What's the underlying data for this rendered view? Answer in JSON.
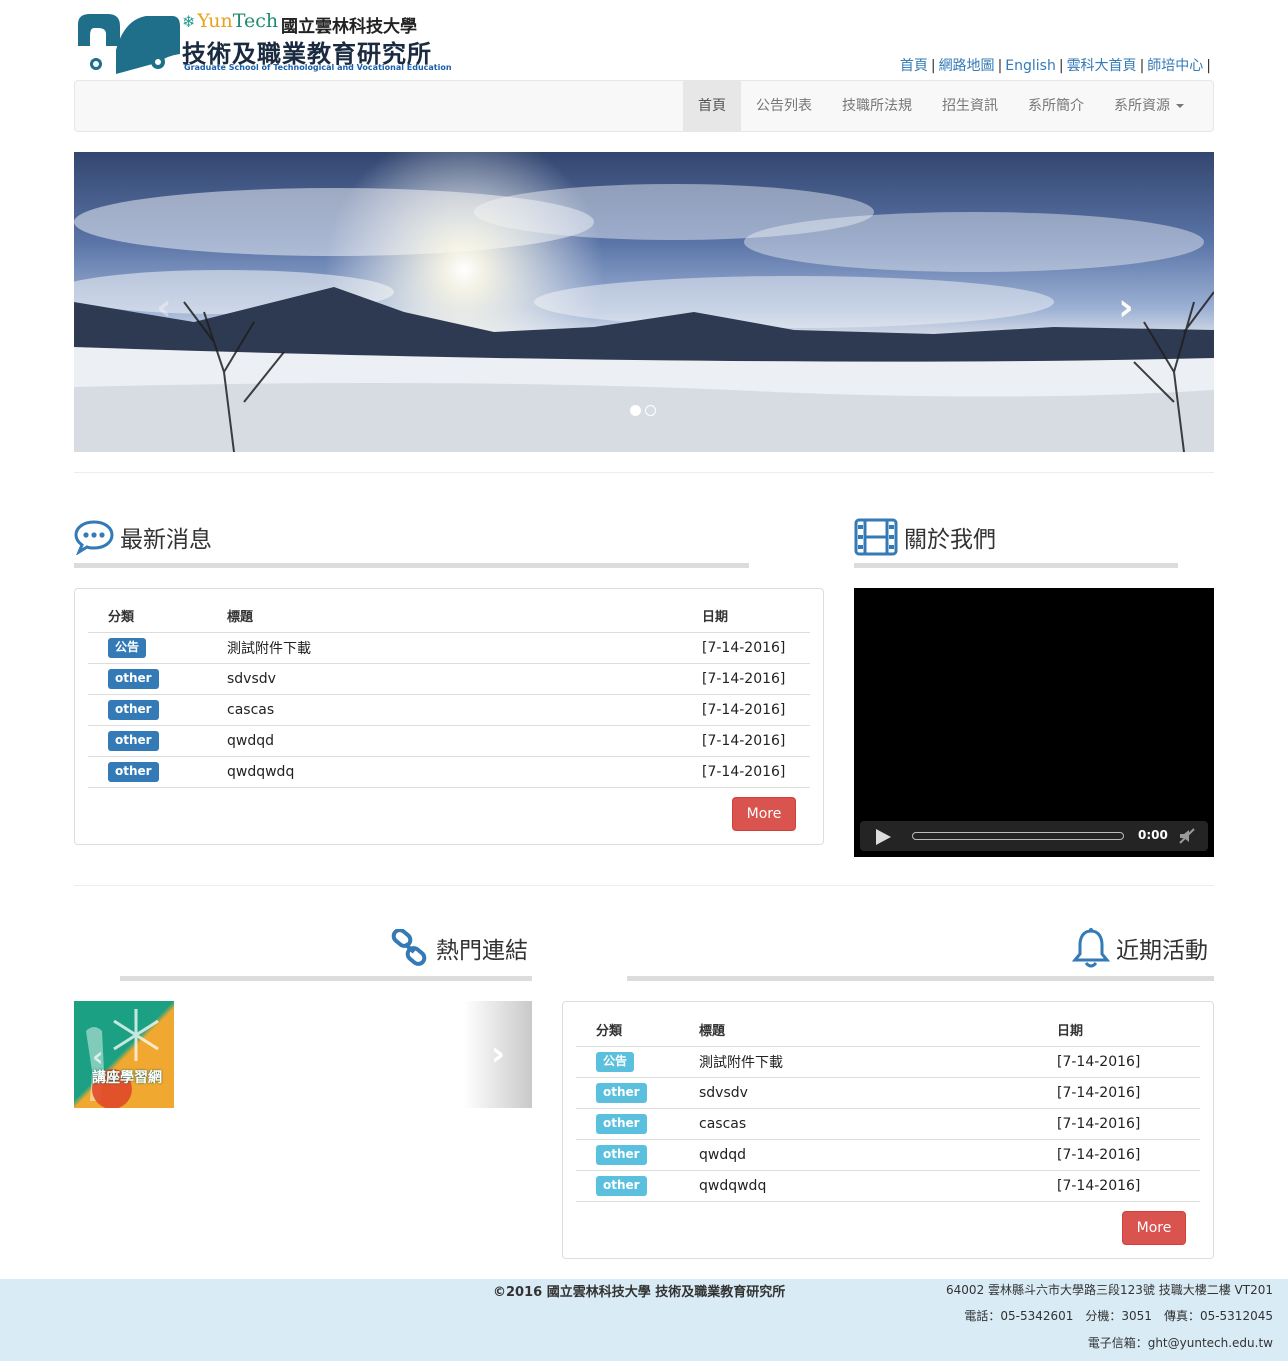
{
  "header": {
    "logo_brand_prefix": "Yun",
    "logo_brand_suffix": "Tech",
    "logo_university": "國立雲林科技大學",
    "logo_school": "技術及職業教育研究所",
    "logo_subtitle": "Graduate School of Technological and Vocational Education",
    "top_links": [
      "首頁",
      "網路地圖",
      "English",
      "雲科大首頁",
      "師培中心"
    ]
  },
  "nav": {
    "items": [
      "首頁",
      "公告列表",
      "技職所法規",
      "招生資訊",
      "系所簡介",
      "系所資源"
    ],
    "active_index": 0
  },
  "carousel": {
    "slide_count": 2,
    "active_slide": 1,
    "prev_glyph": "‹",
    "next_glyph": "›"
  },
  "news": {
    "title": "最新消息",
    "columns": [
      "分類",
      "標題",
      "日期"
    ],
    "rows": [
      {
        "category": "公告",
        "title": "測試附件下載",
        "date": "[7-14-2016]"
      },
      {
        "category": "other",
        "title": "sdvsdv",
        "date": "[7-14-2016]"
      },
      {
        "category": "other",
        "title": "cascas",
        "date": "[7-14-2016]"
      },
      {
        "category": "other",
        "title": "qwdqd",
        "date": "[7-14-2016]"
      },
      {
        "category": "other",
        "title": "qwdqwdq",
        "date": "[7-14-2016]"
      }
    ],
    "more_label": "More"
  },
  "about": {
    "title": "關於我們",
    "video_time": "0:00"
  },
  "links": {
    "title": "熱門連結",
    "items": [
      {
        "label": "講座學習網"
      }
    ],
    "next_glyph": "›",
    "prev_glyph": "‹"
  },
  "events": {
    "title": "近期活動",
    "columns": [
      "分類",
      "標題",
      "日期"
    ],
    "rows": [
      {
        "category": "公告",
        "title": "測試附件下載",
        "date": "[7-14-2016]"
      },
      {
        "category": "other",
        "title": "sdvsdv",
        "date": "[7-14-2016]"
      },
      {
        "category": "other",
        "title": "cascas",
        "date": "[7-14-2016]"
      },
      {
        "category": "other",
        "title": "qwdqd",
        "date": "[7-14-2016]"
      },
      {
        "category": "other",
        "title": "qwdqwdq",
        "date": "[7-14-2016]"
      }
    ],
    "more_label": "More"
  },
  "footer": {
    "copyright": "©2016 國立雲林科技大學 技術及職業教育研究所",
    "address": "64002 雲林縣斗六市大學路三段123號 技職大樓二樓 VT201",
    "phone_line": "電話：05-5342601　分機：3051　傳真：05-5312045",
    "email_line": "電子信箱：ght@yuntech.edu.tw"
  },
  "colors": {
    "primary_label": "#337ab7",
    "info_label": "#5bc0de",
    "more_button": "#d9534f",
    "footer_bg": "#d9ebf5",
    "link": "#337ab7"
  }
}
